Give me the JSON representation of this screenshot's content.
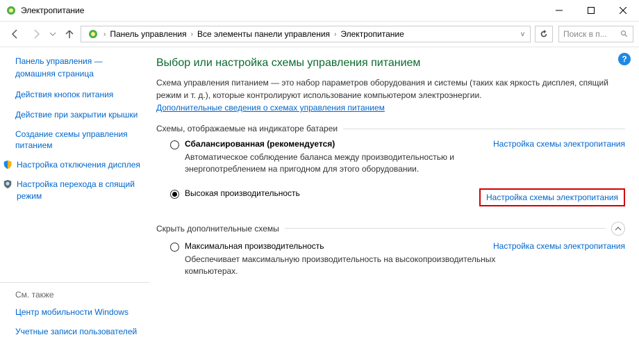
{
  "window": {
    "title": "Электропитание"
  },
  "breadcrumbs": {
    "items": [
      "Панель управления",
      "Все элементы панели управления",
      "Электропитание"
    ],
    "search_placeholder": "Поиск в п..."
  },
  "sidebar": {
    "home_line1": "Панель управления —",
    "home_line2": "домашняя страница",
    "links": {
      "buttons": "Действия кнопок питания",
      "lid": "Действие при закрытии крышки",
      "create": "Создание схемы управления питанием",
      "display": "Настройка отключения дисплея",
      "sleep": "Настройка перехода в спящий режим"
    },
    "see_also_label": "См. также",
    "see_also": {
      "mobility": "Центр мобильности Windows",
      "accounts": "Учетные записи пользователей"
    }
  },
  "main": {
    "heading": "Выбор или настройка схемы управления питанием",
    "desc": "Схема управления питанием — это набор параметров оборудования и системы (таких как яркость дисплея, спящий режим и т. д.), которые контролируют использование компьютером электроэнергии.",
    "more_link": "Дополнительные сведения о схемах управления питанием",
    "section_battery": "Схемы, отображаемые на индикаторе батареи",
    "section_hidden": "Скрыть дополнительные схемы",
    "configure_link": "Настройка схемы электропитания",
    "plans": {
      "balanced": {
        "name": "Сбалансированная (рекомендуется)",
        "desc": "Автоматическое соблюдение баланса между производительностью и энергопотреблением на пригодном для этого оборудовании."
      },
      "high": {
        "name": "Высокая производительность"
      },
      "max": {
        "name": "Максимальная производительность",
        "desc": "Обеспечивает максимальную производительность на высокопроизводительных компьютерах."
      }
    }
  }
}
